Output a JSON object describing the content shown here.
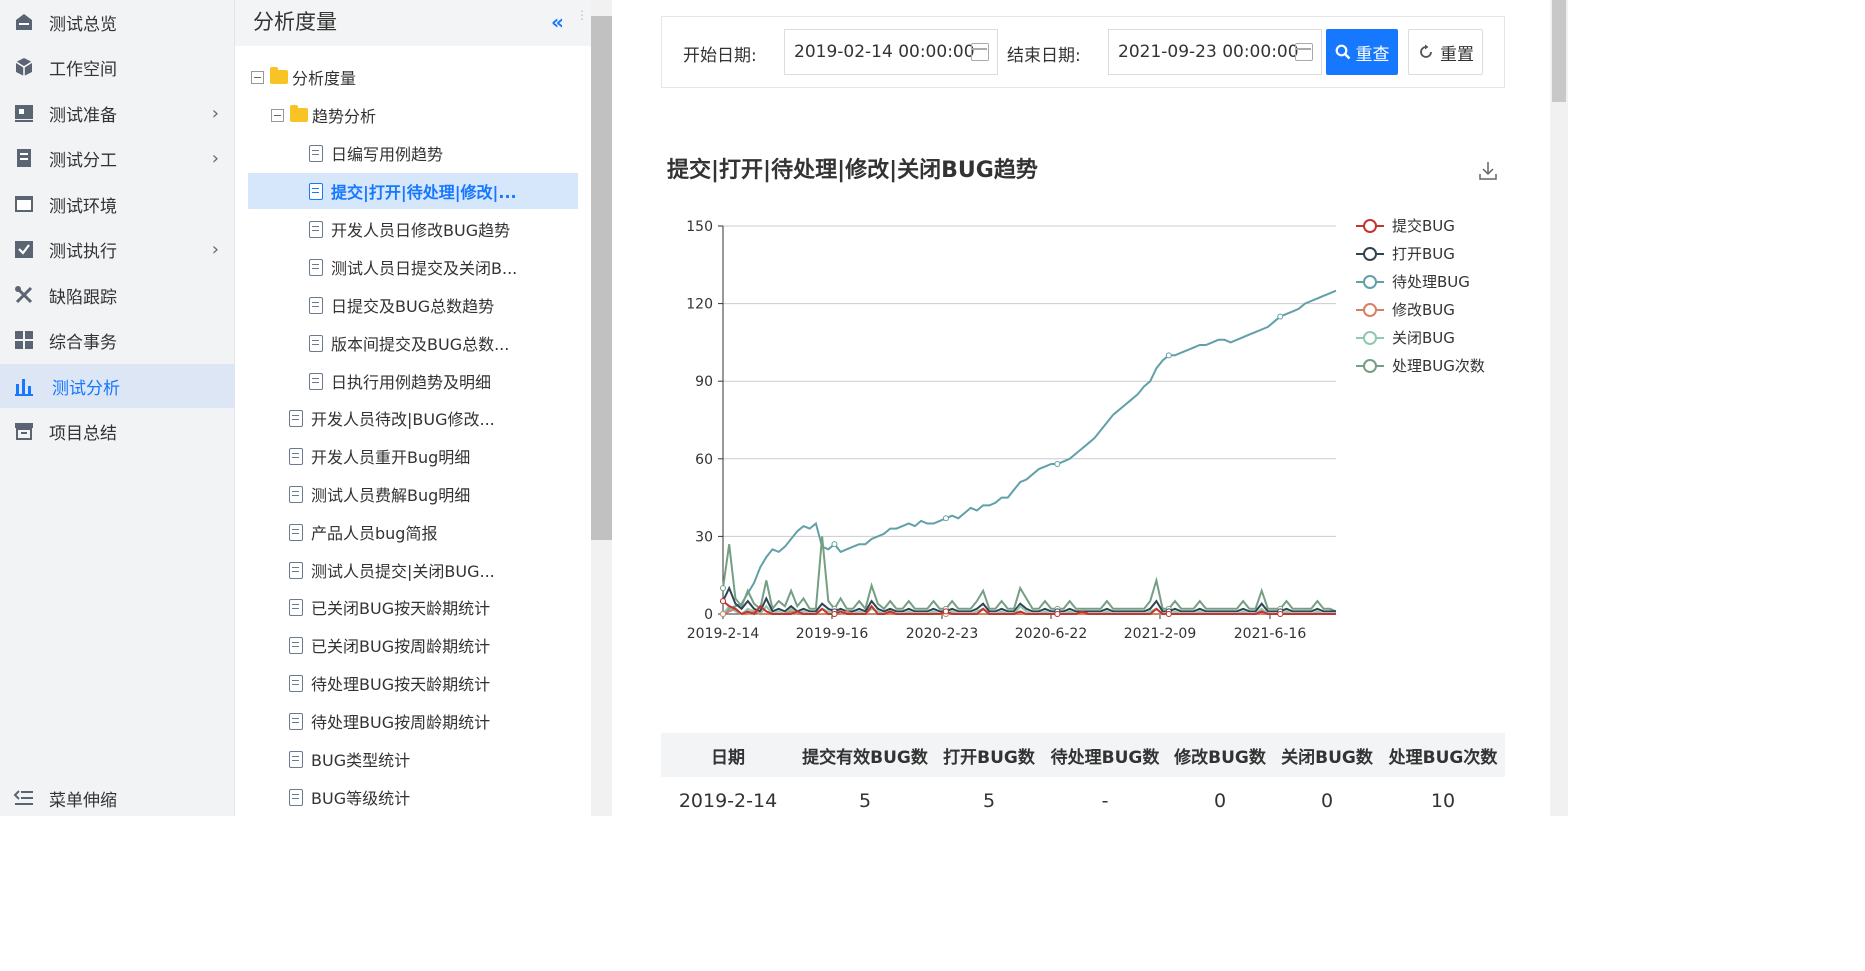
{
  "nav": {
    "items": [
      {
        "label": "测试总览",
        "icon": "dashboard-icon",
        "arrow": false,
        "active": false
      },
      {
        "label": "工作空间",
        "icon": "cube-icon",
        "arrow": false,
        "active": false
      },
      {
        "label": "测试准备",
        "icon": "board-icon",
        "arrow": true,
        "active": false
      },
      {
        "label": "测试分工",
        "icon": "document-icon",
        "arrow": true,
        "active": false
      },
      {
        "label": "测试环境",
        "icon": "window-icon",
        "arrow": false,
        "active": false
      },
      {
        "label": "测试执行",
        "icon": "checkbox-icon",
        "arrow": true,
        "active": false
      },
      {
        "label": "缺陷跟踪",
        "icon": "tools-icon",
        "arrow": false,
        "active": false
      },
      {
        "label": "综合事务",
        "icon": "grid-icon",
        "arrow": false,
        "active": false
      },
      {
        "label": "测试分析",
        "icon": "bar-chart-icon",
        "arrow": false,
        "active": true
      },
      {
        "label": "项目总结",
        "icon": "archive-icon",
        "arrow": false,
        "active": false
      }
    ],
    "footer_label": "菜单伸缩",
    "arrow_glyph": "›"
  },
  "tree": {
    "title": "分析度量",
    "collapse_glyph": "«",
    "dots": "⋮",
    "nodes": [
      {
        "label": "分析度量",
        "kind": "folder",
        "selected": false
      },
      {
        "label": "趋势分析",
        "kind": "folder",
        "selected": false
      },
      {
        "label": "日编写用例趋势",
        "kind": "doc",
        "selected": false
      },
      {
        "label": "提交|打开|待处理|修改|...",
        "kind": "doc",
        "selected": true
      },
      {
        "label": "开发人员日修改BUG趋势",
        "kind": "doc",
        "selected": false
      },
      {
        "label": "测试人员日提交及关闭B...",
        "kind": "doc",
        "selected": false
      },
      {
        "label": "日提交及BUG总数趋势",
        "kind": "doc",
        "selected": false
      },
      {
        "label": "版本间提交及BUG总数...",
        "kind": "doc",
        "selected": false
      },
      {
        "label": "日执行用例趋势及明细",
        "kind": "doc",
        "selected": false
      },
      {
        "label": "开发人员待改|BUG修改...",
        "kind": "doc",
        "selected": false
      },
      {
        "label": "开发人员重开Bug明细",
        "kind": "doc",
        "selected": false
      },
      {
        "label": "测试人员费解Bug明细",
        "kind": "doc",
        "selected": false
      },
      {
        "label": "产品人员bug简报",
        "kind": "doc",
        "selected": false
      },
      {
        "label": "测试人员提交|关闭BUG...",
        "kind": "doc",
        "selected": false
      },
      {
        "label": "已关闭BUG按天龄期统计",
        "kind": "doc",
        "selected": false
      },
      {
        "label": "已关闭BUG按周龄期统计",
        "kind": "doc",
        "selected": false
      },
      {
        "label": "待处理BUG按天龄期统计",
        "kind": "doc",
        "selected": false
      },
      {
        "label": "待处理BUG按周龄期统计",
        "kind": "doc",
        "selected": false
      },
      {
        "label": "BUG类型统计",
        "kind": "doc",
        "selected": false
      },
      {
        "label": "BUG等级统计",
        "kind": "doc",
        "selected": false
      }
    ]
  },
  "filter": {
    "start_label": "开始日期:",
    "start_value": "2019-02-14 00:00:00",
    "end_label": "结束日期:",
    "end_value": "2021-09-23 00:00:00",
    "search_label": "重查",
    "reset_label": "重置"
  },
  "chart_title": "提交|打开|待处理|修改|关闭BUG趋势",
  "colors": {
    "accent": "#1677ff",
    "submit": "#c23531",
    "open": "#2f4554",
    "pending": "#61a0a8",
    "modify": "#d48265",
    "close": "#91c7ae",
    "handle": "#749f83"
  },
  "chart_data": {
    "type": "line",
    "x_ticks": [
      "2019-2-14",
      "2019-9-16",
      "2020-2-23",
      "2020-6-22",
      "2021-2-09",
      "2021-6-16"
    ],
    "y_ticks": [
      0,
      30,
      60,
      90,
      120,
      150
    ],
    "ylim": [
      0,
      150
    ],
    "grid": true,
    "legend_position": "right",
    "series": [
      {
        "name": "提交BUG",
        "color": "#c23531",
        "values": [
          5,
          3,
          2,
          0,
          1,
          0,
          3,
          1,
          0,
          0,
          0,
          0,
          1,
          0,
          0,
          0,
          2,
          0,
          0,
          1,
          0,
          0,
          0,
          0,
          3,
          0,
          0,
          1,
          0,
          0,
          0,
          0,
          0,
          0,
          0,
          0,
          1,
          0,
          0,
          0,
          0,
          0,
          2,
          0,
          0,
          0,
          0,
          0,
          1,
          0,
          0,
          0,
          0,
          0,
          0,
          0,
          0,
          0,
          1,
          0,
          0,
          0,
          0,
          0,
          0,
          0,
          0,
          0,
          0,
          0,
          2,
          0,
          0,
          0,
          0,
          0,
          0,
          0,
          0,
          0,
          0,
          0,
          0,
          0,
          0,
          0,
          0,
          1,
          0,
          0,
          0,
          0,
          0,
          0,
          0,
          0,
          0,
          0,
          0,
          0
        ]
      },
      {
        "name": "打开BUG",
        "color": "#2f4554",
        "values": [
          5,
          10,
          4,
          2,
          5,
          2,
          1,
          6,
          1,
          2,
          1,
          3,
          1,
          2,
          1,
          1,
          4,
          2,
          1,
          2,
          1,
          1,
          2,
          1,
          5,
          2,
          1,
          2,
          1,
          1,
          2,
          1,
          1,
          1,
          2,
          1,
          1,
          2,
          1,
          1,
          1,
          2,
          4,
          1,
          1,
          2,
          1,
          1,
          4,
          2,
          1,
          1,
          2,
          1,
          1,
          1,
          2,
          1,
          1,
          1,
          1,
          1,
          2,
          1,
          1,
          1,
          1,
          1,
          1,
          2,
          5,
          1,
          1,
          2,
          1,
          1,
          1,
          2,
          1,
          1,
          1,
          1,
          1,
          1,
          2,
          1,
          1,
          4,
          1,
          1,
          1,
          2,
          1,
          1,
          1,
          1,
          2,
          1,
          1,
          1
        ]
      },
      {
        "name": "待处理BUG",
        "color": "#61a0a8",
        "values": [
          0,
          2,
          3,
          4,
          8,
          12,
          18,
          22,
          25,
          24,
          26,
          29,
          32,
          34,
          33,
          35,
          26,
          25,
          27,
          24,
          25,
          26,
          27,
          27,
          29,
          30,
          31,
          33,
          33,
          34,
          35,
          34,
          36,
          35,
          35,
          36,
          37,
          38,
          37,
          39,
          41,
          40,
          42,
          42,
          43,
          45,
          45,
          48,
          51,
          52,
          54,
          56,
          57,
          58,
          58,
          59,
          60,
          62,
          64,
          66,
          68,
          71,
          74,
          77,
          79,
          81,
          83,
          85,
          88,
          90,
          95,
          98,
          100,
          100,
          101,
          102,
          103,
          104,
          104,
          105,
          106,
          106,
          105,
          106,
          107,
          108,
          109,
          110,
          111,
          113,
          115,
          116,
          117,
          118,
          120,
          121,
          122,
          123,
          124,
          125
        ]
      },
      {
        "name": "修改BUG",
        "color": "#d48265",
        "values": [
          0,
          1,
          2,
          0,
          0,
          1,
          0,
          0,
          0,
          0,
          0,
          1,
          0,
          0,
          0,
          0,
          0,
          0,
          0,
          0,
          1,
          0,
          0,
          0,
          0,
          0,
          0,
          0,
          0,
          0,
          0,
          0,
          0,
          0,
          0,
          0,
          0,
          0,
          0,
          0,
          0,
          0,
          0,
          0,
          0,
          0,
          0,
          0,
          0,
          0,
          0,
          0,
          0,
          0,
          0,
          0,
          0,
          0,
          0,
          0,
          0,
          0,
          0,
          0,
          0,
          0,
          0,
          0,
          0,
          0,
          0,
          0,
          0,
          0,
          0,
          0,
          0,
          0,
          0,
          0,
          0,
          0,
          0,
          0,
          0,
          0,
          0,
          0,
          0,
          0,
          0,
          0,
          0,
          0,
          0,
          0,
          0,
          0,
          0,
          0
        ]
      },
      {
        "name": "关闭BUG",
        "color": "#91c7ae",
        "values": [
          0,
          3,
          1,
          0,
          2,
          1,
          0,
          3,
          0,
          1,
          0,
          2,
          0,
          1,
          0,
          0,
          2,
          1,
          0,
          1,
          0,
          0,
          1,
          0,
          2,
          1,
          0,
          1,
          0,
          0,
          1,
          0,
          0,
          0,
          1,
          0,
          0,
          1,
          0,
          0,
          0,
          1,
          2,
          0,
          0,
          1,
          0,
          0,
          3,
          1,
          0,
          0,
          1,
          0,
          0,
          0,
          1,
          0,
          0,
          0,
          0,
          0,
          1,
          0,
          0,
          0,
          0,
          0,
          0,
          1,
          2,
          0,
          0,
          1,
          0,
          0,
          0,
          1,
          0,
          0,
          0,
          0,
          0,
          0,
          1,
          0,
          0,
          2,
          0,
          0,
          0,
          1,
          0,
          0,
          0,
          0,
          1,
          0,
          0,
          0
        ]
      },
      {
        "name": "处理BUG次数",
        "color": "#749f83",
        "values": [
          10,
          27,
          6,
          3,
          9,
          4,
          2,
          13,
          2,
          5,
          3,
          9,
          3,
          6,
          2,
          2,
          30,
          5,
          2,
          6,
          2,
          2,
          5,
          2,
          11,
          4,
          2,
          5,
          2,
          2,
          5,
          2,
          2,
          2,
          5,
          2,
          2,
          5,
          2,
          2,
          2,
          5,
          9,
          2,
          2,
          5,
          2,
          2,
          10,
          6,
          2,
          2,
          5,
          2,
          2,
          2,
          5,
          2,
          2,
          2,
          2,
          2,
          5,
          2,
          2,
          2,
          2,
          2,
          2,
          5,
          13,
          2,
          2,
          5,
          2,
          2,
          2,
          5,
          2,
          2,
          2,
          2,
          2,
          2,
          5,
          2,
          2,
          9,
          2,
          2,
          2,
          5,
          2,
          2,
          2,
          2,
          5,
          2,
          2,
          1
        ]
      }
    ]
  },
  "table": {
    "headers": [
      "日期",
      "提交有效BUG数",
      "打开BUG数",
      "待处理BUG数",
      "修改BUG数",
      "关闭BUG数",
      "处理BUG次数"
    ],
    "rows": [
      [
        "2019-2-14",
        "5",
        "5",
        "-",
        "0",
        "0",
        "10"
      ]
    ]
  }
}
